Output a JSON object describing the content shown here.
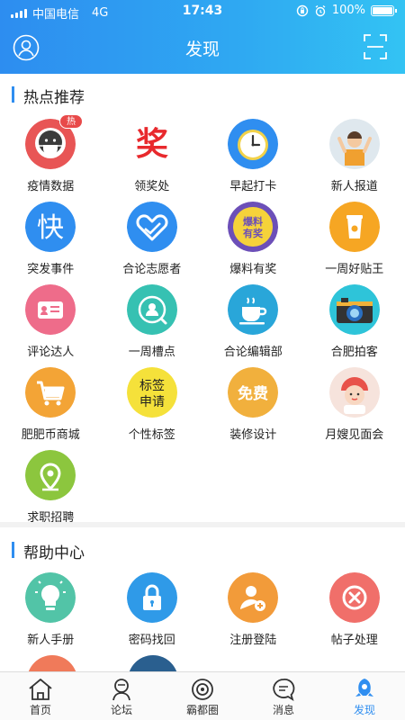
{
  "status_bar": {
    "carrier": "中国电信",
    "network": "4G",
    "time": "17:43",
    "battery": "100%"
  },
  "header": {
    "title": "发现"
  },
  "hot": {
    "title": "热点推荐",
    "badge": "热",
    "items": [
      {
        "label": "疫情数据",
        "icon": "mask-face-icon",
        "color": "#e85555"
      },
      {
        "label": "领奖处",
        "icon": "prize-jiang-icon",
        "color": "#e8292d",
        "glyph": "奖"
      },
      {
        "label": "早起打卡",
        "icon": "clock-icon",
        "color": "#2f8ef0"
      },
      {
        "label": "新人报道",
        "icon": "new-person-icon",
        "color": "#f0a030"
      },
      {
        "label": "突发事件",
        "icon": "kuai-icon",
        "color": "#2f8ef0",
        "glyph": "快"
      },
      {
        "label": "合论志愿者",
        "icon": "heart-hand-icon",
        "color": "#2f8ef0"
      },
      {
        "label": "爆料有奖",
        "icon": "baoliao-icon",
        "color": "#6c4fb8",
        "glyph": "爆料有奖"
      },
      {
        "label": "一周好贴王",
        "icon": "cup-icon",
        "color": "#f6a623"
      },
      {
        "label": "评论达人",
        "icon": "id-card-icon",
        "color": "#ee6c8a"
      },
      {
        "label": "一周槽点",
        "icon": "user-search-icon",
        "color": "#36c1b2"
      },
      {
        "label": "合论编辑部",
        "icon": "coffee-icon",
        "color": "#29a6d9"
      },
      {
        "label": "合肥拍客",
        "icon": "camera-icon",
        "color": "#2a6fc0"
      },
      {
        "label": "肥肥币商城",
        "icon": "cart-icon",
        "color": "#f3a436"
      },
      {
        "label": "个性标签",
        "icon": "tag-text-icon",
        "color": "#f5e13a",
        "glyph": "标签申请"
      },
      {
        "label": "装修设计",
        "icon": "free-icon",
        "color": "#f1b03d",
        "glyph": "免费"
      },
      {
        "label": "月嫂见面会",
        "icon": "nanny-icon",
        "color": "#e8524a"
      },
      {
        "label": "求职招聘",
        "icon": "location-pin-icon",
        "color": "#8cc63e"
      }
    ]
  },
  "help": {
    "title": "帮助中心",
    "items": [
      {
        "label": "新人手册",
        "icon": "lightbulb-icon",
        "color": "#52c4a7"
      },
      {
        "label": "密码找回",
        "icon": "lock-icon",
        "color": "#2f9ae8"
      },
      {
        "label": "注册登陆",
        "icon": "user-add-icon",
        "color": "#f29b3a"
      },
      {
        "label": "帖子处理",
        "icon": "close-circle-icon",
        "color": "#f06f6a"
      }
    ]
  },
  "tabbar": {
    "items": [
      {
        "label": "首页",
        "icon": "home-icon"
      },
      {
        "label": "论坛",
        "icon": "forum-icon"
      },
      {
        "label": "霸都圈",
        "icon": "circle-icon"
      },
      {
        "label": "消息",
        "icon": "message-icon"
      },
      {
        "label": "发现",
        "icon": "discover-icon",
        "active": true
      }
    ]
  }
}
